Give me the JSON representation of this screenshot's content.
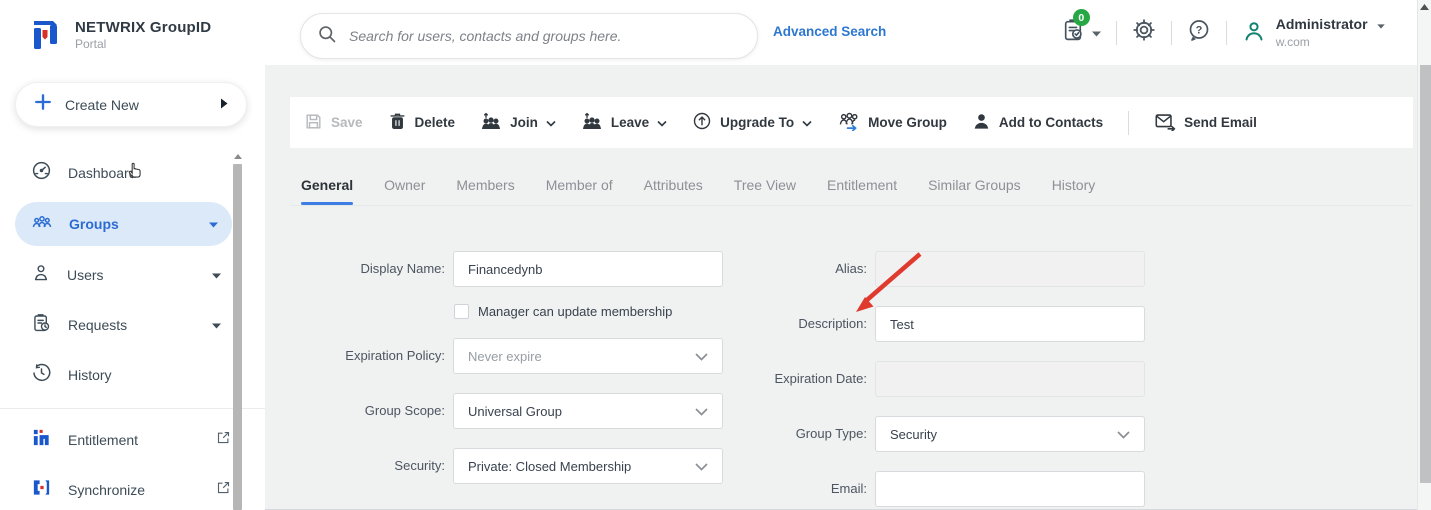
{
  "brand": {
    "name": "NETWRIX GroupID",
    "subtitle": "Portal"
  },
  "sidebar": {
    "create_new": {
      "label": "Create New",
      "icon": "plus-icon"
    },
    "items": [
      {
        "label": "Dashboard",
        "icon": "dashboard-icon",
        "active": false,
        "caret": false
      },
      {
        "label": "Groups",
        "icon": "groups-icon",
        "active": true,
        "caret": true
      },
      {
        "label": "Users",
        "icon": "user-icon",
        "active": false,
        "caret": true
      },
      {
        "label": "Requests",
        "icon": "requests-icon",
        "active": false,
        "caret": true
      },
      {
        "label": "History",
        "icon": "history-icon",
        "active": false,
        "caret": false
      }
    ],
    "external_items": [
      {
        "label": "Entitlement",
        "icon": "entitlement-logo-icon"
      },
      {
        "label": "Synchronize",
        "icon": "synchronize-logo-icon"
      }
    ]
  },
  "topbar": {
    "search": {
      "placeholder": "Search for users, contacts and groups here.",
      "value": "",
      "icon": "search-icon"
    },
    "advanced_search_label": "Advanced Search",
    "notifications": {
      "count": "0",
      "icon": "clipboard-check-icon"
    },
    "icons": [
      "gear-icon",
      "help-icon",
      "profile-icon"
    ],
    "user": {
      "name": "Administrator",
      "domain": "w.com"
    }
  },
  "toolbar": {
    "save": "Save",
    "delete": "Delete",
    "join": "Join",
    "leave": "Leave",
    "upgrade_to": "Upgrade To",
    "move_group": "Move Group",
    "add_to_contacts": "Add to Contacts",
    "send_email": "Send Email"
  },
  "tabs": {
    "active": "General",
    "items": [
      "General",
      "Owner",
      "Members",
      "Member of",
      "Attributes",
      "Tree View",
      "Entitlement",
      "Similar Groups",
      "History"
    ]
  },
  "form": {
    "left": {
      "display_name": {
        "label": "Display Name:",
        "value": "Financedynb"
      },
      "manager_checkbox": {
        "label": "Manager can update membership",
        "checked": false
      },
      "expiration_policy": {
        "label": "Expiration Policy:",
        "value": "Never expire"
      },
      "group_scope": {
        "label": "Group Scope:",
        "value": "Universal Group"
      },
      "security": {
        "label": "Security:",
        "value": "Private: Closed Membership"
      }
    },
    "right": {
      "alias": {
        "label": "Alias:",
        "value": "",
        "disabled": true
      },
      "description": {
        "label": "Description:",
        "value": "Test"
      },
      "expiration_date": {
        "label": "Expiration Date:",
        "value": "",
        "disabled": true
      },
      "group_type": {
        "label": "Group Type:",
        "value": "Security"
      },
      "email": {
        "label": "Email:",
        "value": ""
      }
    }
  },
  "annotations": {
    "red_arrow_target": "description-field"
  },
  "colors": {
    "accent_blue": "#2b6cd4",
    "link_blue": "#2e77d0",
    "tab_underline": "#3d7de4",
    "active_pill_bg": "#dce9f8",
    "badge_green": "#27a844",
    "profile_teal": "#118273",
    "annotation_red": "#e03a2f",
    "brand_blue": "#1a56cc",
    "brand_red": "#d93025",
    "main_bg": "#f0f1f1"
  }
}
